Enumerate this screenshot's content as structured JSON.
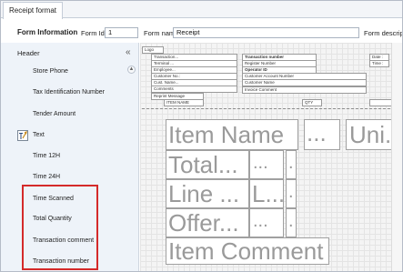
{
  "tab": {
    "label": "Receipt format"
  },
  "form": {
    "title": "Form Information",
    "form_id_label": "Form Id",
    "form_id_value": "1",
    "form_name_label": "Form name",
    "form_name_value": "Receipt",
    "form_desc_label": "Form descript"
  },
  "sidebar": {
    "header": "Header",
    "collapse_glyph": "«",
    "items": [
      "Store Phone",
      "Tax Identification Number",
      "Tender Amount",
      "Text",
      "Time 12H",
      "Time 24H",
      "Time Scanned",
      "Total Quantity",
      "Transaction comment",
      "Transaction number"
    ]
  },
  "designer": {
    "logo": "Logo",
    "left_fields": [
      "Transaction...",
      "Terminal ...",
      "Employee...",
      "Customer No.:",
      "Cust. Name...",
      "Comments"
    ],
    "reprint": "Reprint Message",
    "item_name_small": "ITEM NAME",
    "qty_small": "QTY",
    "mid_fields": [
      "Transaction number",
      "Register Number",
      "Operator ID",
      "Customer Account Number",
      "Customer Name",
      "Invoice Comment"
    ],
    "right_fields": [
      "Date :",
      "Time :"
    ],
    "big_item_name": "Item Name",
    "big_dots1": "...",
    "big_unit": "Uni...",
    "big_total": "Total...",
    "big_dots": "...",
    "big_dot": ".",
    "big_line": "Line ...",
    "big_l": "L...",
    "big_offer": "Offer...",
    "big_item_comment": "Item Comment"
  }
}
